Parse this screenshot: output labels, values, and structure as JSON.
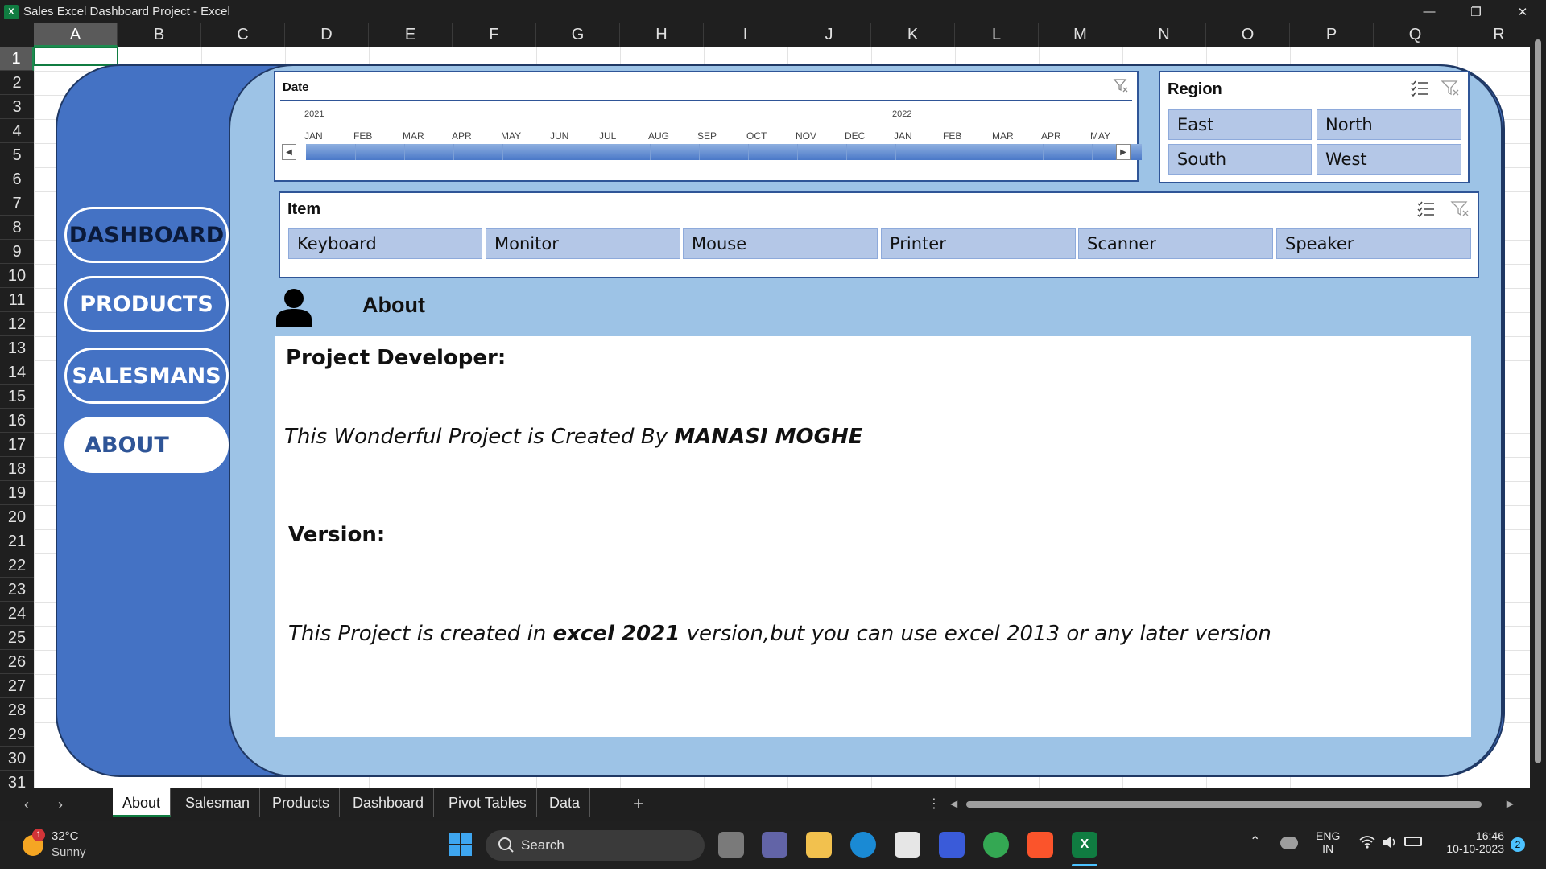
{
  "window": {
    "title": "Sales Excel Dashboard Project - Excel",
    "app_icon": "X",
    "controls": [
      "minimize-icon",
      "restore-icon",
      "close-icon"
    ]
  },
  "grid": {
    "columns": [
      "A",
      "B",
      "C",
      "D",
      "E",
      "F",
      "G",
      "H",
      "I",
      "J",
      "K",
      "L",
      "M",
      "N",
      "O",
      "P",
      "Q",
      "R"
    ],
    "rows": [
      "1",
      "2",
      "3",
      "4",
      "5",
      "6",
      "7",
      "8",
      "9",
      "10",
      "11",
      "12",
      "13",
      "14",
      "15",
      "16",
      "17",
      "18",
      "19",
      "20",
      "21",
      "22",
      "23",
      "24",
      "25",
      "26",
      "27",
      "28",
      "29",
      "30",
      "31"
    ],
    "selected_cell": "A1"
  },
  "nav": {
    "dashboard": "DASHBOARD",
    "products": "PRODUCTS",
    "salesmans": "SALESMANS",
    "about": "ABOUT"
  },
  "timeline": {
    "header": "Date",
    "years": [
      "2021",
      "2022"
    ],
    "months": [
      "JAN",
      "FEB",
      "MAR",
      "APR",
      "MAY",
      "JUN",
      "JUL",
      "AUG",
      "SEP",
      "OCT",
      "NOV",
      "DEC",
      "JAN",
      "FEB",
      "MAR",
      "APR",
      "MAY"
    ]
  },
  "region_slicer": {
    "header": "Region",
    "items": [
      "East",
      "North",
      "South",
      "West"
    ]
  },
  "item_slicer": {
    "header": "Item",
    "items": [
      "Keyboard",
      "Monitor",
      "Mouse",
      "Printer",
      "Scanner",
      "Speaker"
    ]
  },
  "about": {
    "title": "About",
    "developer_heading": "Project  Developer:",
    "developer_text_prefix": "This Wonderful Project is Created By ",
    "developer_name": "MANASI MOGHE",
    "version_heading": "Version:",
    "version_text_prefix": "This Project is created in ",
    "version_bold": "excel 2021",
    "version_text_suffix": " version,but you can use excel 2013 or any later version"
  },
  "sheet_tabs": {
    "tabs": [
      "About",
      "Salesman",
      "Products",
      "Dashboard",
      "Pivot Tables",
      "Data"
    ],
    "active": "About",
    "add_label": "+",
    "more_label": "⋮"
  },
  "taskbar": {
    "weather_temp": "32°C",
    "weather_desc": "Sunny",
    "weather_badge": "1",
    "search_placeholder": "Search",
    "language_line1": "ENG",
    "language_line2": "IN",
    "time": "16:46",
    "date": "10-10-2023",
    "notification_count": "2"
  },
  "colors": {
    "outer_frame": "#4472c4",
    "inner_frame": "#9dc3e6",
    "slicer_button": "#b4c7e7",
    "excel_green": "#107c41"
  }
}
